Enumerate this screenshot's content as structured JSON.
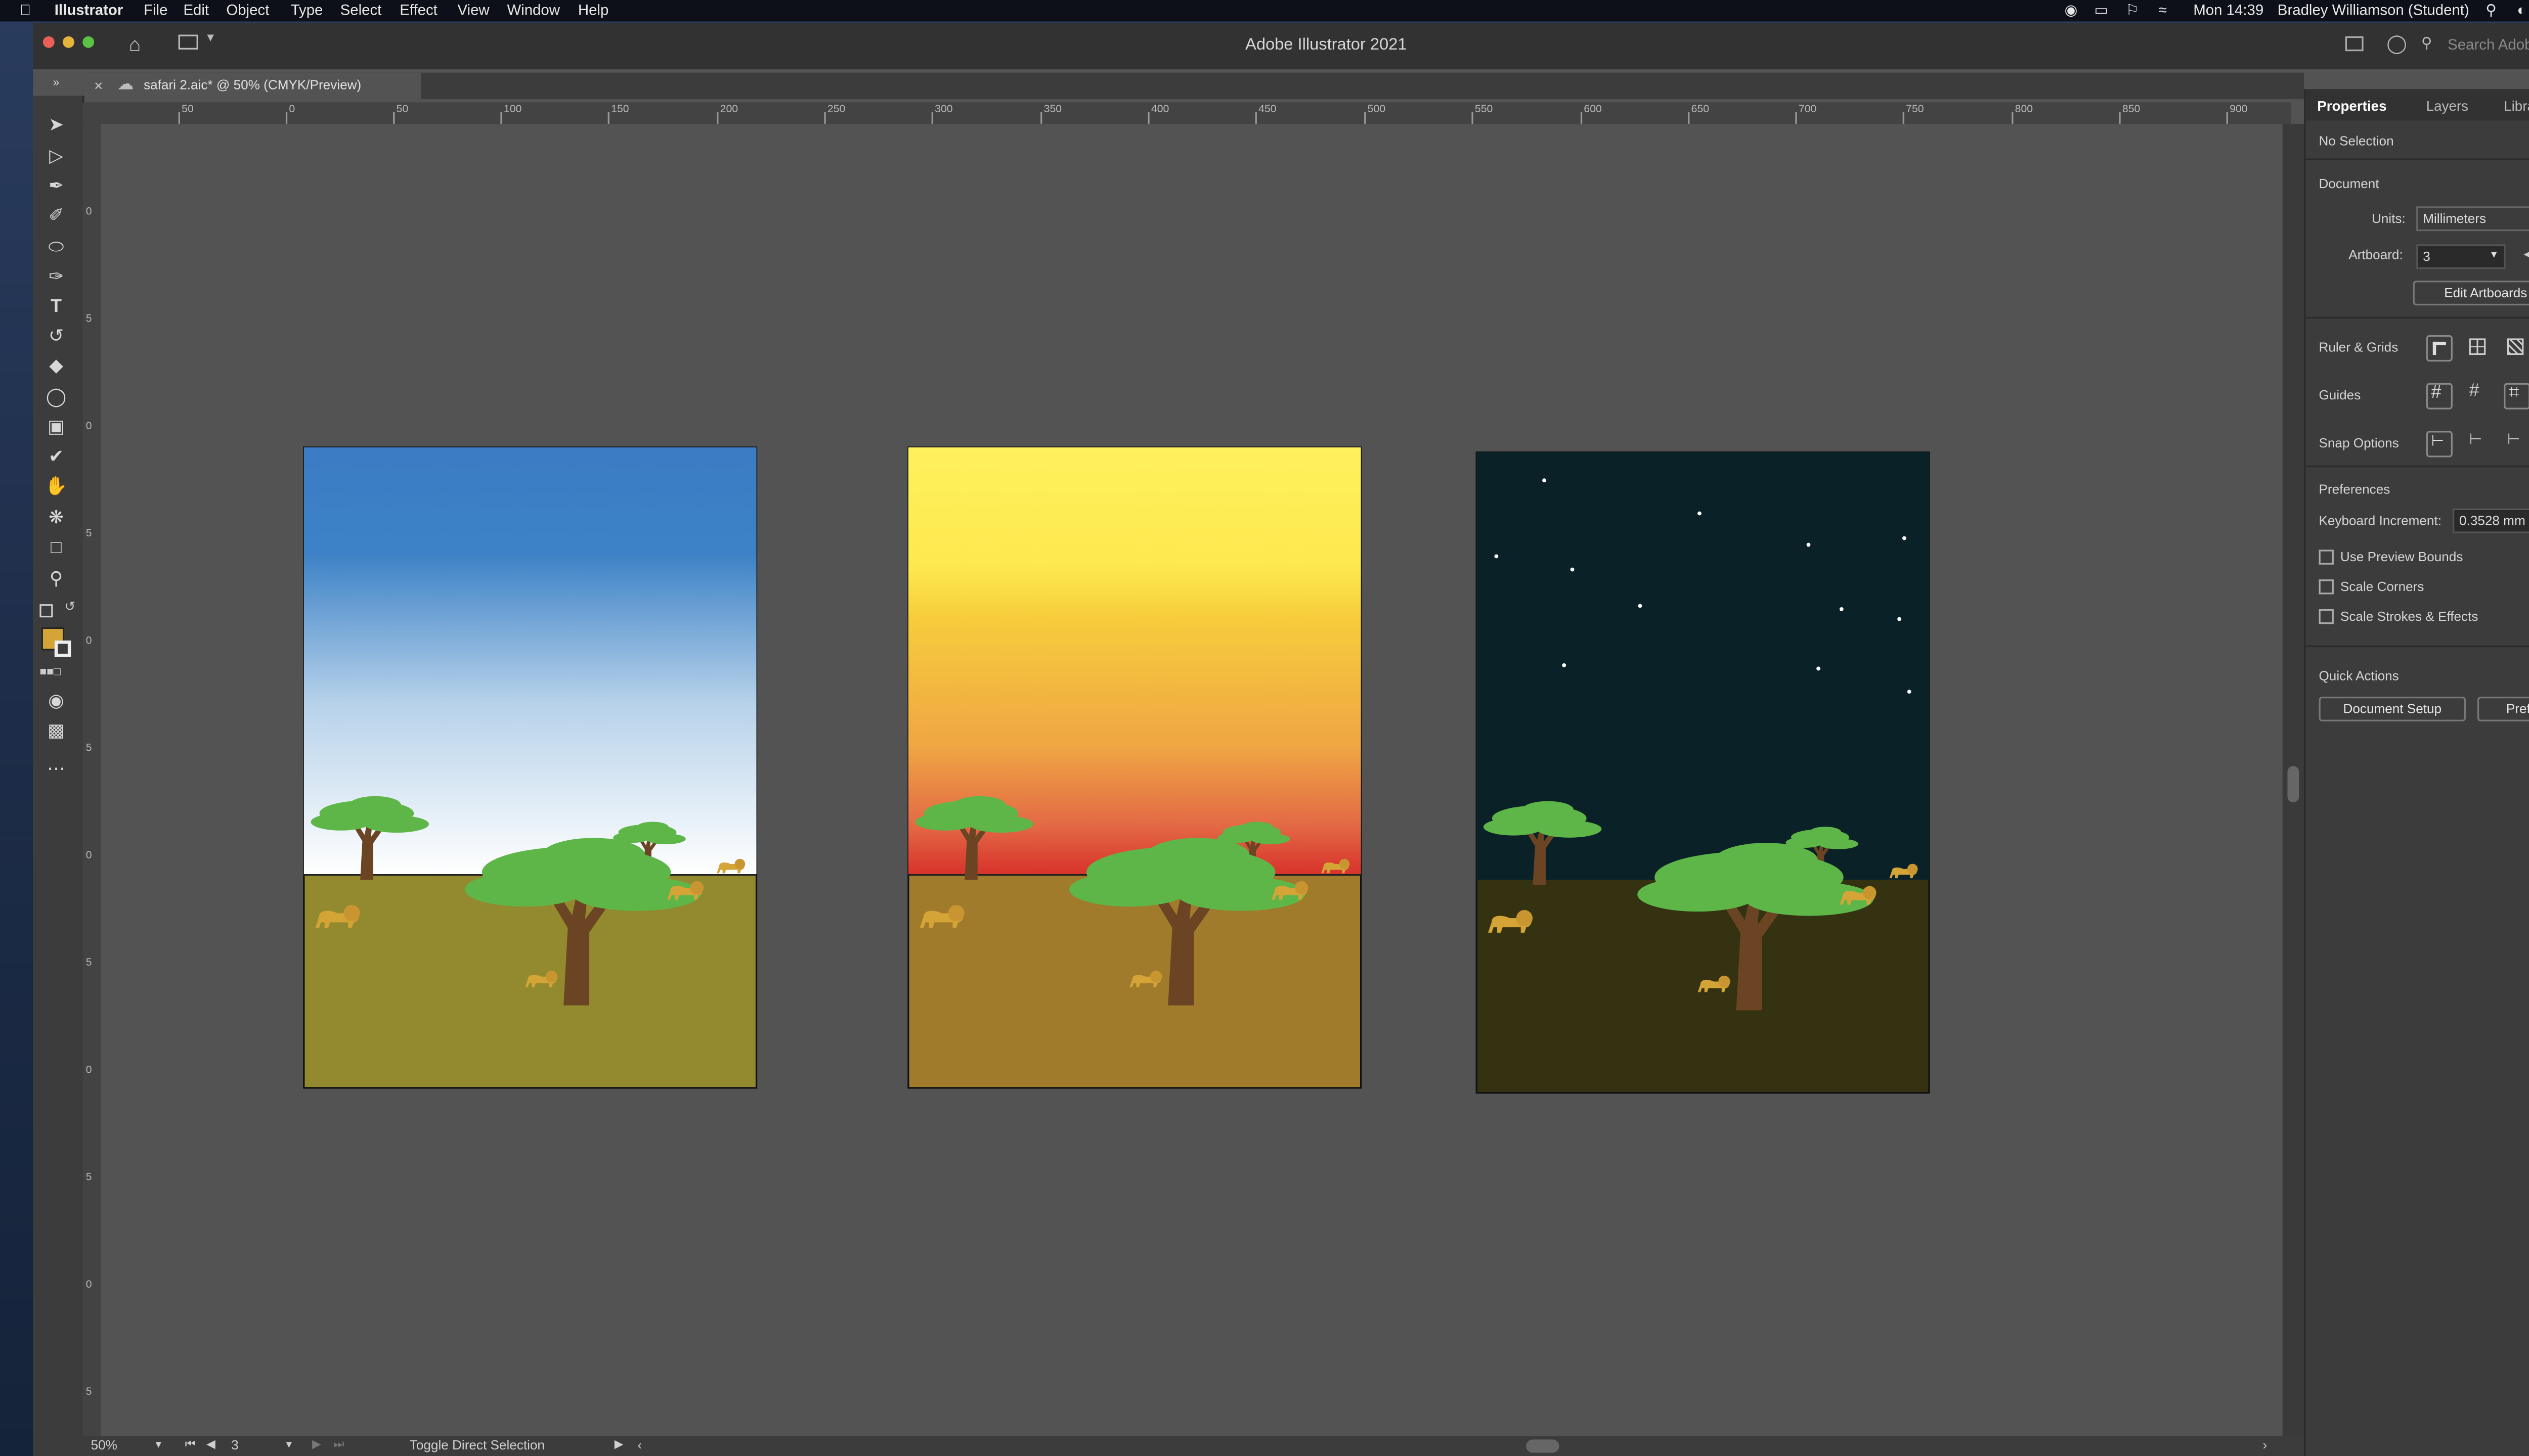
{
  "menubar": {
    "app_name": "Illustrator",
    "items": [
      "File",
      "Edit",
      "Object",
      "Type",
      "Select",
      "Effect",
      "View",
      "Window",
      "Help"
    ],
    "clock": "Mon 14:39",
    "user": "Bradley Williamson (Student)"
  },
  "window": {
    "title": "Adobe Illustrator 2021",
    "search_placeholder": "Search Adobe Help"
  },
  "document_tab": {
    "title": "safari 2.aic* @ 50% (CMYK/Preview)"
  },
  "ruler": {
    "top_labels": [
      "50",
      "0",
      "50",
      "100",
      "150",
      "200",
      "250",
      "300",
      "350",
      "400",
      "450",
      "500",
      "550",
      "600",
      "650",
      "700",
      "750",
      "800",
      "850",
      "900"
    ],
    "left_labels": [
      "0",
      "5",
      "0",
      "5",
      "0",
      "5",
      "0",
      "5",
      "0",
      "5",
      "0",
      "5",
      "0"
    ]
  },
  "panel": {
    "tabs": {
      "properties": "Properties",
      "layers": "Layers",
      "libraries": "Libraries"
    },
    "no_selection": "No Selection",
    "document_heading": "Document",
    "units_label": "Units:",
    "units_value": "Millimeters",
    "artboard_label": "Artboard:",
    "artboard_value": "3",
    "edit_artboards": "Edit Artboards",
    "ruler_grids": "Ruler & Grids",
    "guides": "Guides",
    "snap_options": "Snap Options",
    "preferences_heading": "Preferences",
    "keyboard_increment_label": "Keyboard Increment:",
    "keyboard_increment_value": "0.3528 mm",
    "use_preview_bounds": "Use Preview Bounds",
    "scale_corners": "Scale Corners",
    "scale_strokes": "Scale Strokes & Effects",
    "quick_actions": "Quick Actions",
    "document_setup": "Document Setup",
    "preferences_button": "Preferences"
  },
  "statusbar": {
    "zoom": "50%",
    "artboard_nav": "3",
    "tool_hint": "Toggle Direct Selection"
  },
  "colors": {
    "day_sky_top": "#3b7cc4",
    "day_ground": "#938a2f",
    "sunset_sky_top": "#fff05c",
    "sunset_horizon": "#d8322c",
    "sunset_ground": "#a07b2c",
    "night_sky": "#0a2227",
    "night_ground": "#353212",
    "tree_leaves": "#5eb648",
    "tree_trunk": "#6b4423",
    "lion": "#d4a437",
    "fill_swatch": "#d4a437"
  },
  "artboards": [
    {
      "scene": "day"
    },
    {
      "scene": "sunset"
    },
    {
      "scene": "night"
    }
  ]
}
